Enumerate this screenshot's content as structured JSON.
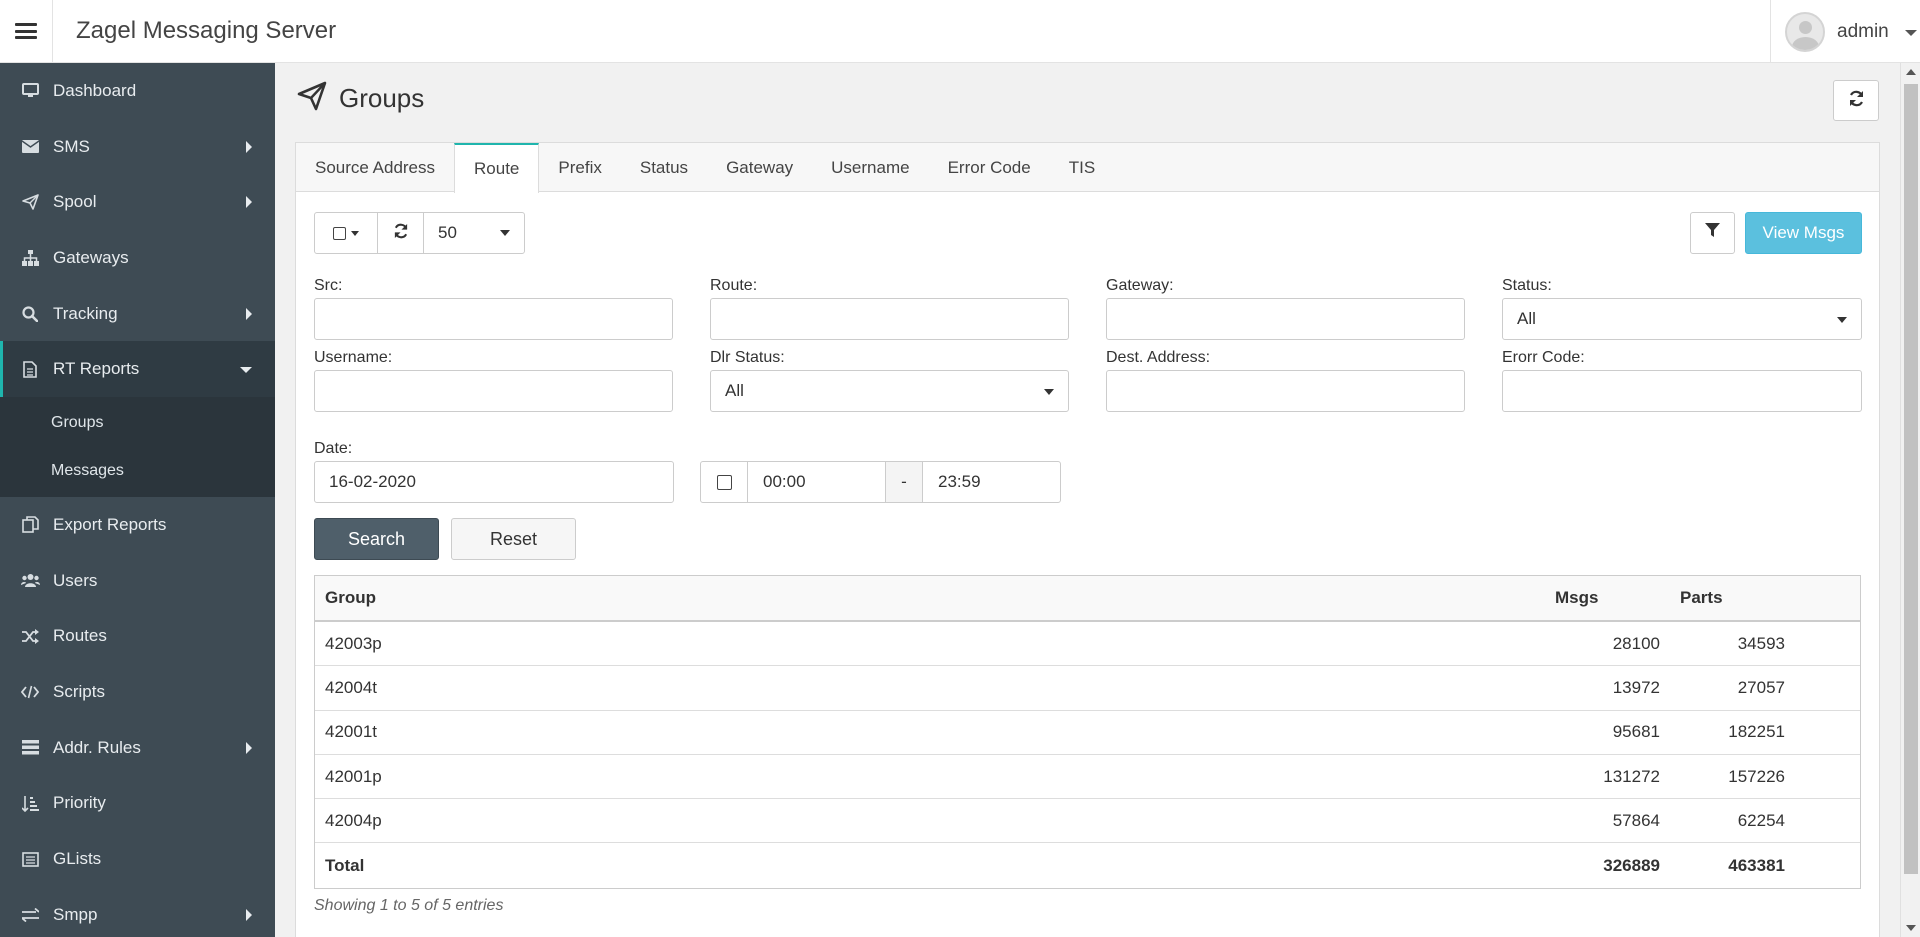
{
  "app": {
    "title": "Zagel Messaging Server",
    "user": "admin"
  },
  "sidebar": {
    "items": [
      {
        "label": "Dashboard",
        "icon": "desktop-icon"
      },
      {
        "label": "SMS",
        "icon": "envelope-icon"
      },
      {
        "label": "Spool",
        "icon": "paper-plane-icon"
      },
      {
        "label": "Gateways",
        "icon": "sitemap-icon"
      },
      {
        "label": "Tracking",
        "icon": "search-icon"
      },
      {
        "label": "RT Reports",
        "icon": "file-text-icon"
      },
      {
        "label": "Export Reports",
        "icon": "copy-icon"
      },
      {
        "label": "Users",
        "icon": "users-icon"
      },
      {
        "label": "Routes",
        "icon": "random-icon"
      },
      {
        "label": "Scripts",
        "icon": "code-icon"
      },
      {
        "label": "Addr. Rules",
        "icon": "list-icon"
      },
      {
        "label": "Priority",
        "icon": "sort-amount-icon"
      },
      {
        "label": "GLists",
        "icon": "list-alt-icon"
      },
      {
        "label": "Smpp",
        "icon": "exchange-icon"
      }
    ],
    "sub_items": [
      "Groups",
      "Messages"
    ]
  },
  "page": {
    "title": "Groups"
  },
  "tabs": [
    "Source Address",
    "Route",
    "Prefix",
    "Status",
    "Gateway",
    "Username",
    "Error Code",
    "TIS"
  ],
  "toolbar": {
    "page_size": "50",
    "view_msgs": "View Msgs"
  },
  "filters": {
    "src": {
      "label": "Src:",
      "value": ""
    },
    "route": {
      "label": "Route:",
      "value": ""
    },
    "gateway": {
      "label": "Gateway:",
      "value": ""
    },
    "status": {
      "label": "Status:",
      "value": "All"
    },
    "username": {
      "label": "Username:",
      "value": ""
    },
    "dlr_status": {
      "label": "Dlr Status:",
      "value": "All"
    },
    "dest_address": {
      "label": "Dest. Address:",
      "value": ""
    },
    "error_code": {
      "label": "Erorr Code:",
      "value": ""
    },
    "date": {
      "label": "Date:",
      "value": "16-02-2020"
    },
    "time_from": "00:00",
    "time_sep": "-",
    "time_to": "23:59"
  },
  "buttons": {
    "search": "Search",
    "reset": "Reset"
  },
  "table": {
    "headers": {
      "group": "Group",
      "msgs": "Msgs",
      "parts": "Parts"
    },
    "rows": [
      {
        "group": "42003p",
        "msgs": "28100",
        "parts": "34593"
      },
      {
        "group": "42004t",
        "msgs": "13972",
        "parts": "27057"
      },
      {
        "group": "42001t",
        "msgs": "95681",
        "parts": "182251"
      },
      {
        "group": "42001p",
        "msgs": "131272",
        "parts": "157226"
      },
      {
        "group": "42004p",
        "msgs": "57864",
        "parts": "62254"
      }
    ],
    "total": {
      "group": "Total",
      "msgs": "326889",
      "parts": "463381"
    }
  },
  "footer": {
    "entries": "Showing 1 to 5 of 5 entries"
  },
  "colors": {
    "sidebar_bg": "#3e4b54",
    "accent": "#1fb5ad",
    "info_button": "#5bc0de",
    "search_button": "#4f5f6a"
  }
}
